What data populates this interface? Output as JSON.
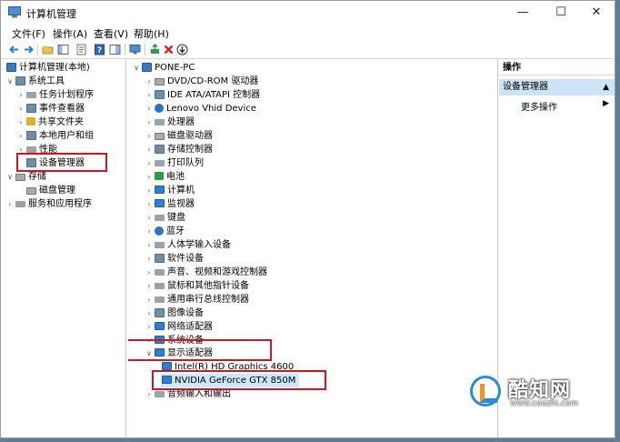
{
  "window": {
    "title": "计算机管理",
    "minimize": "—",
    "maximize": "☐",
    "close": "✕"
  },
  "menu": {
    "file": "文件(F)",
    "action": "操作(A)",
    "view": "查看(V)",
    "help": "帮助(H)"
  },
  "left_tree": {
    "root": "计算机管理(本地)",
    "system_tools": "系统工具",
    "task_scheduler": "任务计划程序",
    "event_viewer": "事件查看器",
    "shared_folders": "共享文件夹",
    "local_users": "本地用户和组",
    "performance": "性能",
    "device_manager": "设备管理器",
    "storage": "存储",
    "disk_management": "磁盘管理",
    "services_apps": "服务和应用程序"
  },
  "device_tree": {
    "root": "PONE-PC",
    "categories": [
      "DVD/CD-ROM 驱动器",
      "IDE ATA/ATAPI 控制器",
      "Lenovo Vhid Device",
      "处理器",
      "磁盘驱动器",
      "存储控制器",
      "打印队列",
      "电池",
      "计算机",
      "监视器",
      "键盘",
      "蓝牙",
      "人体学输入设备",
      "软件设备",
      "声音、视频和游戏控制器",
      "鼠标和其他指针设备",
      "通用串行总线控制器",
      "图像设备",
      "网络适配器",
      "系统设备"
    ],
    "display_adapters": "显示适配器",
    "adapters": [
      "Intel(R) HD Graphics 4600",
      "NVIDIA GeForce GTX 850M"
    ],
    "audio_io": "音频输入和输出"
  },
  "actions": {
    "header": "操作",
    "section": "设备管理器",
    "more": "更多操作",
    "section_arrow": "▲",
    "more_arrow": "▶"
  },
  "watermark": {
    "brand": "酷知网",
    "url": "www.coozhi.com"
  },
  "colors": {
    "highlight_box": "#d7141d",
    "selection": "#cce8ff",
    "action_section": "#cde3f7"
  }
}
